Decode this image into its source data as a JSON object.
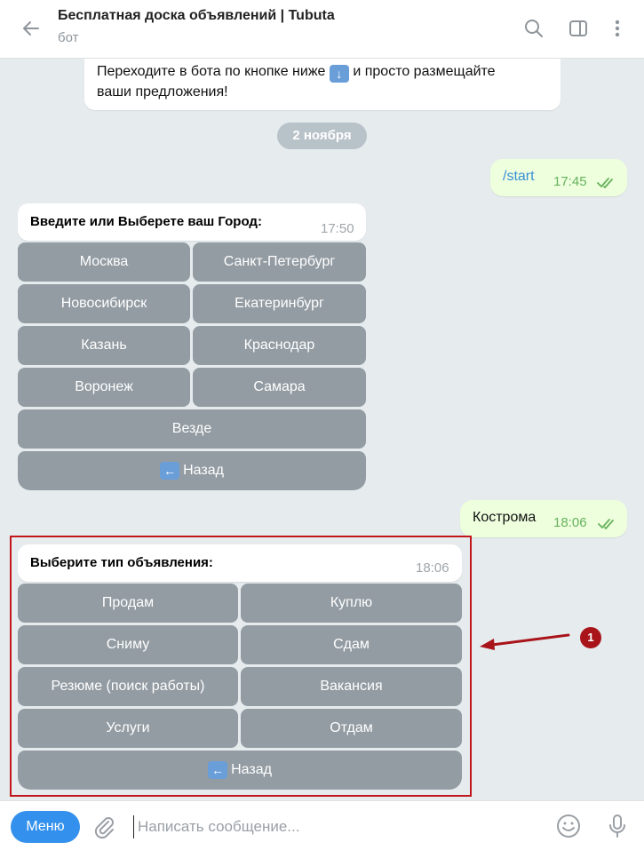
{
  "header": {
    "title": "Бесплатная доска объявлений | Tubuta",
    "subtitle": "бот"
  },
  "prev_message": {
    "line1_before": "Переходите в бота по кнопке ниже",
    "line1_after": "и просто размещайте",
    "line2": "ваши предложения!"
  },
  "date_pill": "2 ноября",
  "out_messages": [
    {
      "text": "/start",
      "time": "17:45"
    },
    {
      "text": "Кострома",
      "time": "18:06"
    }
  ],
  "city_message": {
    "text": "Введите или Выберете ваш Город:",
    "time": "17:50",
    "buttons": [
      "Москва",
      "Санкт-Петербург",
      "Новосибирск",
      "Екатеринбург",
      "Казань",
      "Краснодар",
      "Воронеж",
      "Самара",
      "Везде",
      "Назад"
    ]
  },
  "type_message": {
    "text": "Выберите тип объявления:",
    "time": "18:06",
    "buttons": [
      "Продам",
      "Куплю",
      "Сниму",
      "Сдам",
      "Резюме (поиск работы)",
      "Вакансия",
      "Услуги",
      "Отдам",
      "Назад"
    ]
  },
  "annotation": {
    "number": "1",
    "color": "#a8141a"
  },
  "composer": {
    "menu_label": "Меню",
    "placeholder": "Написать сообщение..."
  },
  "colors": {
    "accent": "#3390ec",
    "out_bubble": "#eeffde",
    "keyboard_button": "#939ca3",
    "highlight": "#c0161c"
  }
}
